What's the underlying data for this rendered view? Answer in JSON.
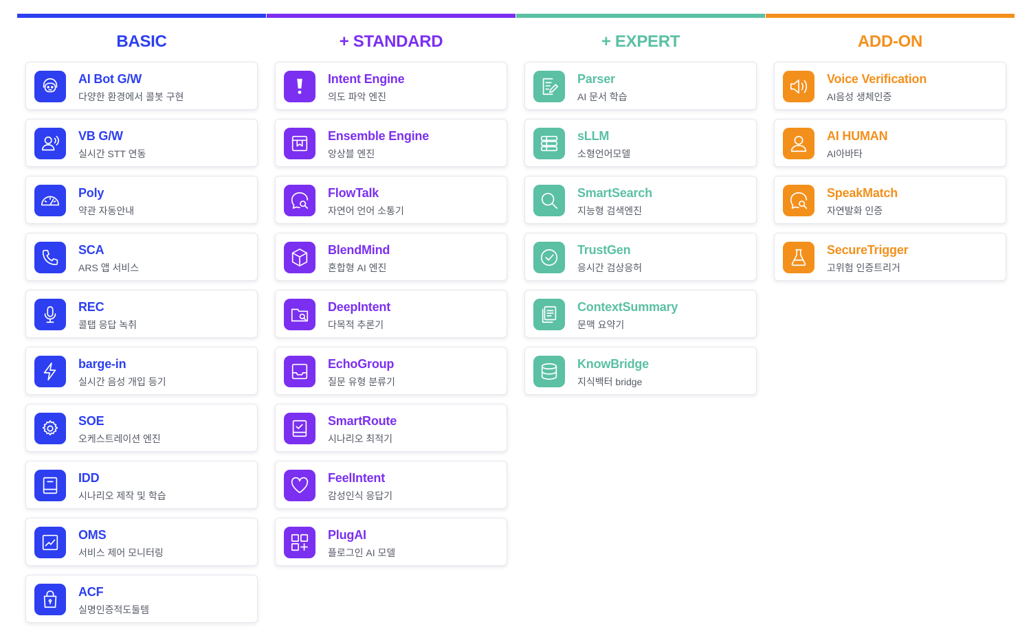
{
  "colors": {
    "basic": "#2d3ff0",
    "standard": "#7b2ff0",
    "expert": "#5bc0a4",
    "addon": "#f3901c"
  },
  "columns": [
    {
      "key": "basic",
      "title": "BASIC",
      "cards": [
        {
          "icon": "headset-bot-icon",
          "title": "AI Bot G/W",
          "subtitle": "다양한 환경에서 콜봇 구현"
        },
        {
          "icon": "user-voice-icon",
          "title": "VB G/W",
          "subtitle": "실시간 STT 연동"
        },
        {
          "icon": "gauge-icon",
          "title": "Poly",
          "subtitle": "약관 자동안내"
        },
        {
          "icon": "phone-icon",
          "title": "SCA",
          "subtitle": "ARS 앱 서비스"
        },
        {
          "icon": "microphone-icon",
          "title": "REC",
          "subtitle": "콜탭 응답 녹취"
        },
        {
          "icon": "lightning-icon",
          "title": "barge-in",
          "subtitle": "실시간 음성 개입 등기"
        },
        {
          "icon": "gear-icon",
          "title": "SOE",
          "subtitle": "오케스트레이션 엔진"
        },
        {
          "icon": "book-icon",
          "title": "IDD",
          "subtitle": "시나리오 제작 및 학습"
        },
        {
          "icon": "chart-icon",
          "title": "OMS",
          "subtitle": "서비스 제어 모니터링"
        },
        {
          "icon": "lock-bag-icon",
          "title": "ACF",
          "subtitle": "실명인증적도둘템"
        }
      ]
    },
    {
      "key": "standard",
      "title": "+ STANDARD",
      "cards": [
        {
          "icon": "exclamation-icon",
          "title": "Intent Engine",
          "subtitle": "의도 파악 엔진"
        },
        {
          "icon": "box-icon",
          "title": "Ensemble Engine",
          "subtitle": "앙상블 엔진"
        },
        {
          "icon": "chat-search-icon",
          "title": "FlowTalk",
          "subtitle": "자연어 언어 소통기"
        },
        {
          "icon": "cube-icon",
          "title": "BlendMind",
          "subtitle": "혼합형 AI 엔진"
        },
        {
          "icon": "folder-search-icon",
          "title": "DeepIntent",
          "subtitle": "다목적 추론기"
        },
        {
          "icon": "inbox-icon",
          "title": "EchoGroup",
          "subtitle": "질문 유형 분류기"
        },
        {
          "icon": "check-book-icon",
          "title": "SmartRoute",
          "subtitle": "시나리오 최적기"
        },
        {
          "icon": "heart-icon",
          "title": "FeelIntent",
          "subtitle": "감성인식 응답기"
        },
        {
          "icon": "grid-plus-icon",
          "title": "PlugAI",
          "subtitle": "플로그인 AI 모델"
        }
      ]
    },
    {
      "key": "expert",
      "title": "+ EXPERT",
      "cards": [
        {
          "icon": "document-edit-icon",
          "title": "Parser",
          "subtitle": "AI 문서 학습"
        },
        {
          "icon": "database-stack-icon",
          "title": "sLLM",
          "subtitle": "소형언어모델"
        },
        {
          "icon": "search-icon",
          "title": "SmartSearch",
          "subtitle": "지능형 검색엔진"
        },
        {
          "icon": "check-circle-icon",
          "title": "TrustGen",
          "subtitle": "응시간 검상응허"
        },
        {
          "icon": "documents-icon",
          "title": "ContextSummary",
          "subtitle": "문맥 요약기"
        },
        {
          "icon": "database-icon",
          "title": "KnowBridge",
          "subtitle": "지식백터 bridge"
        }
      ]
    },
    {
      "key": "addon",
      "title": "ADD-ON",
      "cards": [
        {
          "icon": "speaker-icon",
          "title": "Voice Verification",
          "subtitle": "AI음성 생체인증"
        },
        {
          "icon": "user-icon",
          "title": "AI HUMAN",
          "subtitle": "AI아바타"
        },
        {
          "icon": "chat-search-icon",
          "title": "SpeakMatch",
          "subtitle": "자연발화 인증"
        },
        {
          "icon": "flask-icon",
          "title": "SecureTrigger",
          "subtitle": "고위험 인증트리거"
        }
      ]
    }
  ]
}
